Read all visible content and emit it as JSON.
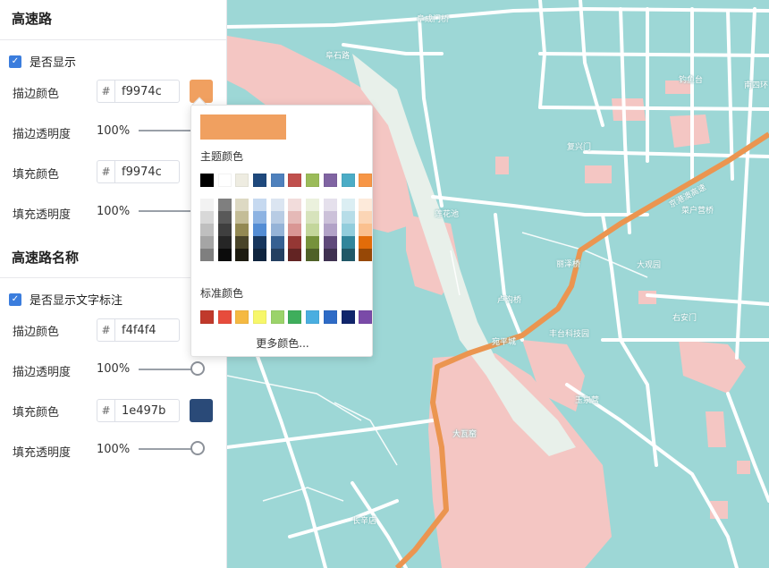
{
  "sections": [
    {
      "title": "高速路",
      "checkbox_label": "是否显示",
      "stroke_color_label": "描边颜色",
      "stroke_color_value": "f9974c",
      "stroke_color_hex": "#f0a060",
      "stroke_opacity_label": "描边透明度",
      "stroke_opacity_value": "100%",
      "fill_color_label": "填充颜色",
      "fill_color_value": "f9974c",
      "fill_opacity_label": "填充透明度",
      "fill_opacity_value": "100%"
    },
    {
      "title": "高速路名称",
      "checkbox_label": "是否显示文字标注",
      "stroke_color_label": "描边颜色",
      "stroke_color_value": "f4f4f4",
      "stroke_opacity_label": "描边透明度",
      "stroke_opacity_value": "100%",
      "fill_color_label": "填充颜色",
      "fill_color_value": "1e497b",
      "fill_color_hex": "#2a4a78",
      "fill_opacity_label": "填充透明度",
      "fill_opacity_value": "100%"
    }
  ],
  "common": {
    "hash": "#"
  },
  "color_picker": {
    "preview_color": "#f0a060",
    "theme_title": "主题颜色",
    "theme_colors": [
      "#000000",
      "#ffffff",
      "#eeece1",
      "#1f497d",
      "#4f81bd",
      "#c0504d",
      "#9bbb59",
      "#8064a2",
      "#4bacc6",
      "#f79646"
    ],
    "theme_shades": [
      [
        "#f2f2f2",
        "#d8d8d8",
        "#bfbfbf",
        "#a5a5a5",
        "#7f7f7f"
      ],
      [
        "#7f7f7f",
        "#595959",
        "#3f3f3f",
        "#262626",
        "#0c0c0c"
      ],
      [
        "#ddd9c3",
        "#c4bd97",
        "#938953",
        "#494429",
        "#1d1b10"
      ],
      [
        "#c6d9f0",
        "#8db3e2",
        "#548dd4",
        "#17365d",
        "#0f243e"
      ],
      [
        "#dbe5f1",
        "#b8cce4",
        "#95b3d7",
        "#366092",
        "#244061"
      ],
      [
        "#f2dcdb",
        "#e5b9b7",
        "#d99694",
        "#953734",
        "#632423"
      ],
      [
        "#ebf1dd",
        "#d7e3bc",
        "#c3d69b",
        "#76923c",
        "#4f6128"
      ],
      [
        "#e5e0ec",
        "#ccc1d9",
        "#b2a2c7",
        "#5f497a",
        "#3f3151"
      ],
      [
        "#dbeef3",
        "#b7dde8",
        "#92cddc",
        "#31859b",
        "#205867"
      ],
      [
        "#fdeada",
        "#fbd5b5",
        "#fac08f",
        "#e36c09",
        "#974806"
      ]
    ],
    "standard_title": "标准颜色",
    "standard_colors": [
      "#c0392b",
      "#e74c3c",
      "#f5b942",
      "#f7f76a",
      "#9bd36a",
      "#3fae5c",
      "#4aaee0",
      "#2e6bc6",
      "#10256b",
      "#7a4aa8"
    ],
    "more_label": "更多颜色..."
  },
  "map": {
    "labels": [
      "阜成门桥",
      "阜石路",
      "钓鱼台",
      "复兴门",
      "莲花池",
      "丽泽桥",
      "大观园",
      "菜户营桥",
      "右安门",
      "卢沟桥",
      "宛平城",
      "丰台科技园",
      "京港澳高速",
      "南四环",
      "长辛店",
      "玉泉营",
      "大瓦窑"
    ]
  }
}
